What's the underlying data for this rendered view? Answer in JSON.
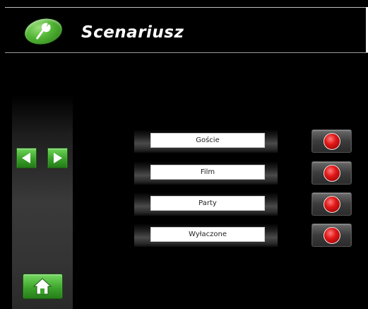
{
  "header": {
    "title": "Scenariusz",
    "icon": "wrench-icon"
  },
  "sidebar": {
    "prev_icon": "arrow-left-icon",
    "next_icon": "arrow-right-icon",
    "home_icon": "home-icon"
  },
  "scenes": [
    {
      "label": "Goście",
      "state_icon": "red-led-icon"
    },
    {
      "label": "Film",
      "state_icon": "red-led-icon"
    },
    {
      "label": "Party",
      "state_icon": "red-led-icon"
    },
    {
      "label": "Wyłaczone",
      "state_icon": "red-led-icon"
    }
  ],
  "colors": {
    "accent_green": "#4fb332",
    "led_red": "#e01717",
    "background": "#000000"
  }
}
